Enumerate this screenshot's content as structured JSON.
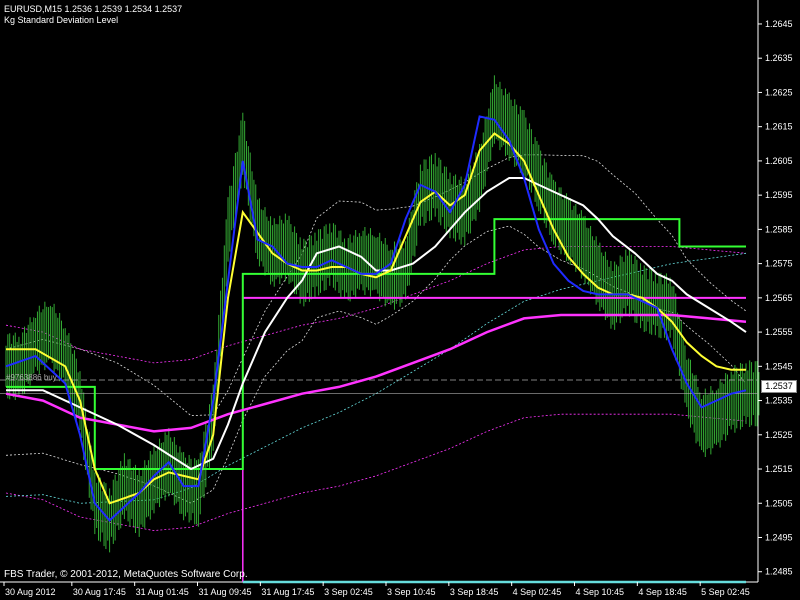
{
  "header": {
    "symbol_line": "EURUSD,M15  1.2536 1.2539 1.2534 1.2537",
    "indicator_name": "Kg Standard Deviation Level"
  },
  "footer": {
    "copyright": "FBS Trader, © 2001-2012, MetaQuotes Software Corp."
  },
  "order_label": "#9763886 buy",
  "current_price": "1.2537",
  "colors": {
    "background": "#000000",
    "candles": "#33aa33",
    "ma_fast": "#1f2bff",
    "ma_medium": "#ffff33",
    "ma_slow": "#ffffff",
    "ma_long": "#ff33ff",
    "step_level": "#33ff33",
    "cyan_level": "#66dddd",
    "axis_text": "#ffffff"
  },
  "chart_data": {
    "type": "line",
    "symbol": "EURUSD",
    "timeframe": "M15",
    "ylim": [
      1.2482,
      1.2652
    ],
    "y_ticks": [
      "1.2645",
      "1.2635",
      "1.2625",
      "1.2615",
      "1.2605",
      "1.2595",
      "1.2585",
      "1.2575",
      "1.2565",
      "1.2555",
      "1.2545",
      "1.2535",
      "1.2525",
      "1.2515",
      "1.2505",
      "1.2495",
      "1.2485"
    ],
    "x_ticks": [
      "30 Aug 2012",
      "30 Aug 17:45",
      "31 Aug 01:45",
      "31 Aug 09:45",
      "31 Aug 17:45",
      "3 Sep 02:45",
      "3 Sep 10:45",
      "3 Sep 18:45",
      "4 Sep 02:45",
      "4 Sep 10:45",
      "4 Sep 18:45",
      "5 Sep 02:45"
    ],
    "x_index_range": [
      0,
      100
    ],
    "price_series": {
      "x": [
        0,
        2,
        4,
        6,
        8,
        10,
        12,
        14,
        16,
        18,
        20,
        22,
        24,
        26,
        28,
        30,
        32,
        34,
        36,
        38,
        40,
        42,
        44,
        46,
        48,
        50,
        52,
        54,
        56,
        58,
        60,
        62,
        64,
        66,
        68,
        70,
        72,
        74,
        76,
        78,
        80,
        82,
        84,
        86,
        88,
        90,
        92,
        94,
        96,
        98,
        100
      ],
      "values": [
        1.2545,
        1.2552,
        1.2555,
        1.2548,
        1.2535,
        1.2505,
        1.25,
        1.251,
        1.2505,
        1.2512,
        1.2517,
        1.251,
        1.2508,
        1.253,
        1.2585,
        1.261,
        1.2585,
        1.2578,
        1.258,
        1.2572,
        1.2575,
        1.2578,
        1.2573,
        1.2576,
        1.2575,
        1.2571,
        1.2573,
        1.2595,
        1.2598,
        1.2592,
        1.259,
        1.26,
        1.262,
        1.2615,
        1.261,
        1.26,
        1.259,
        1.2585,
        1.258,
        1.2572,
        1.2565,
        1.257,
        1.2565,
        1.2563,
        1.2562,
        1.254,
        1.2528,
        1.253,
        1.2535,
        1.2537,
        1.2537
      ]
    },
    "ma_fast": {
      "x": [
        0,
        4,
        8,
        10,
        12,
        14,
        18,
        20,
        22,
        24,
        26,
        28,
        30,
        32,
        34,
        36,
        38,
        40,
        42,
        44,
        46,
        48,
        50,
        52,
        54,
        56,
        58,
        60,
        62,
        64,
        66,
        68,
        70,
        72,
        74,
        76,
        78,
        80,
        82,
        84,
        86,
        88,
        90,
        92,
        94,
        96,
        98,
        100
      ],
      "values": [
        1.2545,
        1.2548,
        1.254,
        1.2525,
        1.2505,
        1.25,
        1.2508,
        1.2513,
        1.2517,
        1.251,
        1.251,
        1.2535,
        1.257,
        1.2605,
        1.2582,
        1.258,
        1.2575,
        1.2574,
        1.2574,
        1.2576,
        1.2574,
        1.2572,
        1.2572,
        1.2575,
        1.2588,
        1.2598,
        1.2596,
        1.259,
        1.2598,
        1.2618,
        1.2617,
        1.2611,
        1.26,
        1.2585,
        1.2575,
        1.257,
        1.2567,
        1.2566,
        1.2566,
        1.2566,
        1.2564,
        1.2562,
        1.255,
        1.254,
        1.2533,
        1.2535,
        1.2537,
        1.2538
      ]
    },
    "ma_medium": {
      "x": [
        0,
        4,
        8,
        10,
        12,
        14,
        18,
        20,
        22,
        24,
        26,
        28,
        30,
        32,
        34,
        36,
        38,
        40,
        42,
        44,
        46,
        48,
        50,
        52,
        54,
        56,
        58,
        60,
        62,
        64,
        66,
        68,
        70,
        72,
        74,
        76,
        78,
        80,
        82,
        84,
        86,
        88,
        90,
        92,
        94,
        96,
        98,
        100
      ],
      "values": [
        1.255,
        1.255,
        1.2545,
        1.2535,
        1.2515,
        1.2505,
        1.2508,
        1.2512,
        1.2514,
        1.2513,
        1.2512,
        1.2525,
        1.2565,
        1.259,
        1.2584,
        1.2578,
        1.2575,
        1.2573,
        1.2573,
        1.2574,
        1.2574,
        1.2572,
        1.2571,
        1.2573,
        1.2583,
        1.2593,
        1.2596,
        1.2592,
        1.2595,
        1.2608,
        1.2613,
        1.261,
        1.2605,
        1.2595,
        1.2585,
        1.2577,
        1.2572,
        1.2568,
        1.2566,
        1.2566,
        1.2565,
        1.2562,
        1.2558,
        1.2552,
        1.2548,
        1.2545,
        1.2544,
        1.2544
      ]
    },
    "ma_slow": {
      "x": [
        0,
        5,
        10,
        15,
        20,
        25,
        28,
        30,
        32,
        35,
        38,
        40,
        42,
        45,
        48,
        50,
        52,
        55,
        58,
        60,
        62,
        65,
        68,
        70,
        72,
        75,
        78,
        80,
        82,
        85,
        88,
        90,
        92,
        95,
        98,
        100
      ],
      "values": [
        1.2538,
        1.2538,
        1.2533,
        1.2528,
        1.2522,
        1.2515,
        1.2518,
        1.2528,
        1.254,
        1.2555,
        1.2565,
        1.257,
        1.2578,
        1.258,
        1.2577,
        1.2573,
        1.2573,
        1.2575,
        1.258,
        1.2585,
        1.259,
        1.2596,
        1.26,
        1.26,
        1.2598,
        1.2595,
        1.2592,
        1.2588,
        1.2583,
        1.2578,
        1.2572,
        1.257,
        1.2566,
        1.2562,
        1.2558,
        1.2555
      ]
    },
    "ma_long": {
      "x": [
        0,
        5,
        10,
        15,
        20,
        25,
        30,
        35,
        40,
        45,
        50,
        55,
        60,
        65,
        70,
        75,
        80,
        85,
        90,
        95,
        100
      ],
      "values": [
        1.2537,
        1.2535,
        1.253,
        1.2528,
        1.2526,
        1.2527,
        1.2531,
        1.2534,
        1.2537,
        1.2539,
        1.2542,
        1.2546,
        1.255,
        1.2555,
        1.2559,
        1.256,
        1.256,
        1.256,
        1.256,
        1.2559,
        1.2558
      ]
    },
    "step_level_green": {
      "x": [
        0,
        12,
        12,
        32,
        32,
        66,
        66,
        91,
        91,
        100
      ],
      "values": [
        1.2539,
        1.2539,
        1.2515,
        1.2515,
        1.2572,
        1.2572,
        1.2588,
        1.2588,
        1.258,
        1.258
      ]
    },
    "magenta_level": {
      "x": [
        32,
        100
      ],
      "value": 1.2565,
      "vertical_at_x": 32
    },
    "cyan_level": {
      "x": [
        32,
        100
      ],
      "value": 1.2482
    },
    "order_line": {
      "value": 1.2541
    },
    "bid_line": {
      "value": 1.2537
    }
  }
}
